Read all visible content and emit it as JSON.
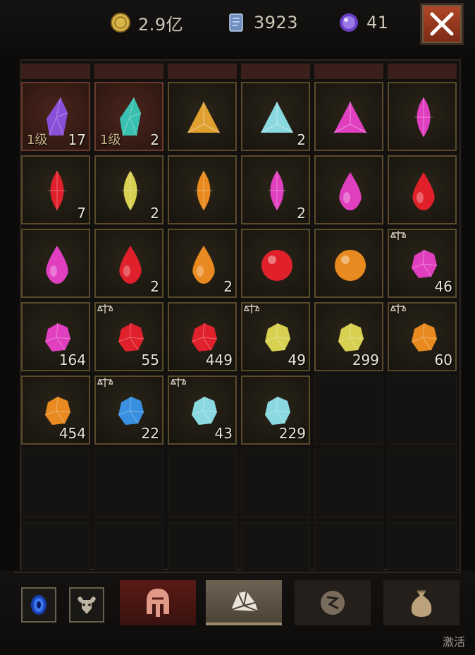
{
  "currencies": {
    "gold": {
      "value": "2.9亿",
      "icon": "gold-coin-icon",
      "color": "#d8b64a"
    },
    "scroll": {
      "value": "3923",
      "icon": "scroll-icon",
      "color": "#7f9ac2"
    },
    "orb": {
      "value": "41",
      "icon": "purple-orb-icon",
      "color": "#8a5fd6"
    }
  },
  "close_button": {
    "icon": "close-icon"
  },
  "slots": [
    {
      "gem": "crystal-purple",
      "level": "1级",
      "count": "17",
      "red": true,
      "scale": false
    },
    {
      "gem": "crystal-teal",
      "level": "1级",
      "count": "2",
      "red": true,
      "scale": false
    },
    {
      "gem": "triangle-amber",
      "level": "",
      "count": "",
      "red": false,
      "scale": false
    },
    {
      "gem": "triangle-cyan",
      "level": "",
      "count": "2",
      "red": false,
      "scale": false
    },
    {
      "gem": "triangle-magenta",
      "level": "",
      "count": "",
      "red": false,
      "scale": false
    },
    {
      "gem": "marquise-magenta",
      "level": "",
      "count": "",
      "red": false,
      "scale": false
    },
    {
      "gem": "marquise-red",
      "level": "",
      "count": "7",
      "red": false,
      "scale": false
    },
    {
      "gem": "marquise-yellow",
      "level": "",
      "count": "2",
      "red": false,
      "scale": false
    },
    {
      "gem": "marquise-orange",
      "level": "",
      "count": "",
      "red": false,
      "scale": false
    },
    {
      "gem": "marquise-magenta",
      "level": "",
      "count": "2",
      "red": false,
      "scale": false
    },
    {
      "gem": "pear-magenta",
      "level": "",
      "count": "",
      "red": false,
      "scale": false
    },
    {
      "gem": "pear-red",
      "level": "",
      "count": "",
      "red": false,
      "scale": false
    },
    {
      "gem": "drop-magenta",
      "level": "",
      "count": "",
      "red": false,
      "scale": false
    },
    {
      "gem": "drop-red",
      "level": "",
      "count": "2",
      "red": false,
      "scale": false
    },
    {
      "gem": "drop-orange",
      "level": "",
      "count": "2",
      "red": false,
      "scale": false
    },
    {
      "gem": "orb-red",
      "level": "",
      "count": "",
      "red": false,
      "scale": false
    },
    {
      "gem": "orb-orange",
      "level": "",
      "count": "",
      "red": false,
      "scale": false
    },
    {
      "gem": "rough-magenta",
      "level": "",
      "count": "46",
      "red": false,
      "scale": true
    },
    {
      "gem": "rough-magenta",
      "level": "",
      "count": "164",
      "red": false,
      "scale": false
    },
    {
      "gem": "rough-red",
      "level": "",
      "count": "55",
      "red": false,
      "scale": true
    },
    {
      "gem": "rough-red",
      "level": "",
      "count": "449",
      "red": false,
      "scale": false
    },
    {
      "gem": "rough-yellow",
      "level": "",
      "count": "49",
      "red": false,
      "scale": true
    },
    {
      "gem": "rough-yellow",
      "level": "",
      "count": "299",
      "red": false,
      "scale": false
    },
    {
      "gem": "rough-orange",
      "level": "",
      "count": "60",
      "red": false,
      "scale": true
    },
    {
      "gem": "rough-orange",
      "level": "",
      "count": "454",
      "red": false,
      "scale": false
    },
    {
      "gem": "rough-blue",
      "level": "",
      "count": "22",
      "red": false,
      "scale": true
    },
    {
      "gem": "rough-cyan",
      "level": "",
      "count": "43",
      "red": false,
      "scale": true
    },
    {
      "gem": "rough-cyan",
      "level": "",
      "count": "229",
      "red": false,
      "scale": false
    }
  ],
  "gem_colors": {
    "purple": "#8a4fd8",
    "teal": "#3ac0b0",
    "amber": "#e0a030",
    "cyan": "#8ad8e0",
    "magenta": "#e040c0",
    "red": "#e0202a",
    "yellow": "#d8d050",
    "orange": "#e88a20",
    "blue": "#3a90e0"
  },
  "bottom_buttons": [
    {
      "icon": "blue-portal-icon"
    },
    {
      "icon": "bull-emblem-icon"
    }
  ],
  "tabs": [
    {
      "icon": "helmet-icon",
      "state": "red"
    },
    {
      "icon": "gem-pile-icon",
      "state": "selected"
    },
    {
      "icon": "rune-icon",
      "state": "normal"
    },
    {
      "icon": "pouch-icon",
      "state": "normal"
    }
  ],
  "watermark": "激活"
}
